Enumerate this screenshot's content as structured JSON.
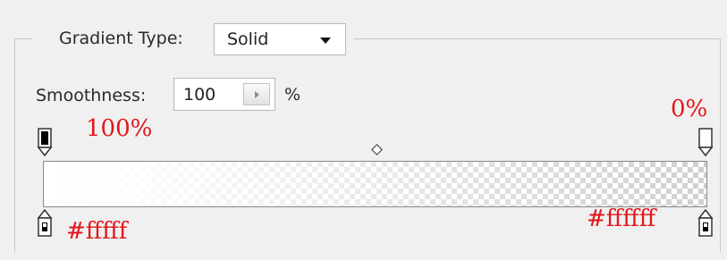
{
  "gradient_type": {
    "label": "Gradient Type:",
    "value": "Solid"
  },
  "smoothness": {
    "label": "Smoothness:",
    "value": "100",
    "unit": "%"
  },
  "annotations": {
    "opacity_left": "100%",
    "opacity_right": "0%",
    "color_left": "#fffff",
    "color_right": "#ffffff"
  },
  "colors": {
    "annotation": "#e3161b",
    "opacity_stop_left": "#000000",
    "opacity_stop_right": "#ffffff",
    "color_stop_left": "#ffffff",
    "color_stop_right": "#ffffff"
  },
  "stops": {
    "opacity": [
      {
        "location_percent": 0,
        "opacity_percent": 100
      },
      {
        "location_percent": 100,
        "opacity_percent": 0
      }
    ],
    "color": [
      {
        "location_percent": 0,
        "color": "#ffffff"
      },
      {
        "location_percent": 100,
        "color": "#ffffff"
      }
    ],
    "midpoint_percent": 50
  }
}
